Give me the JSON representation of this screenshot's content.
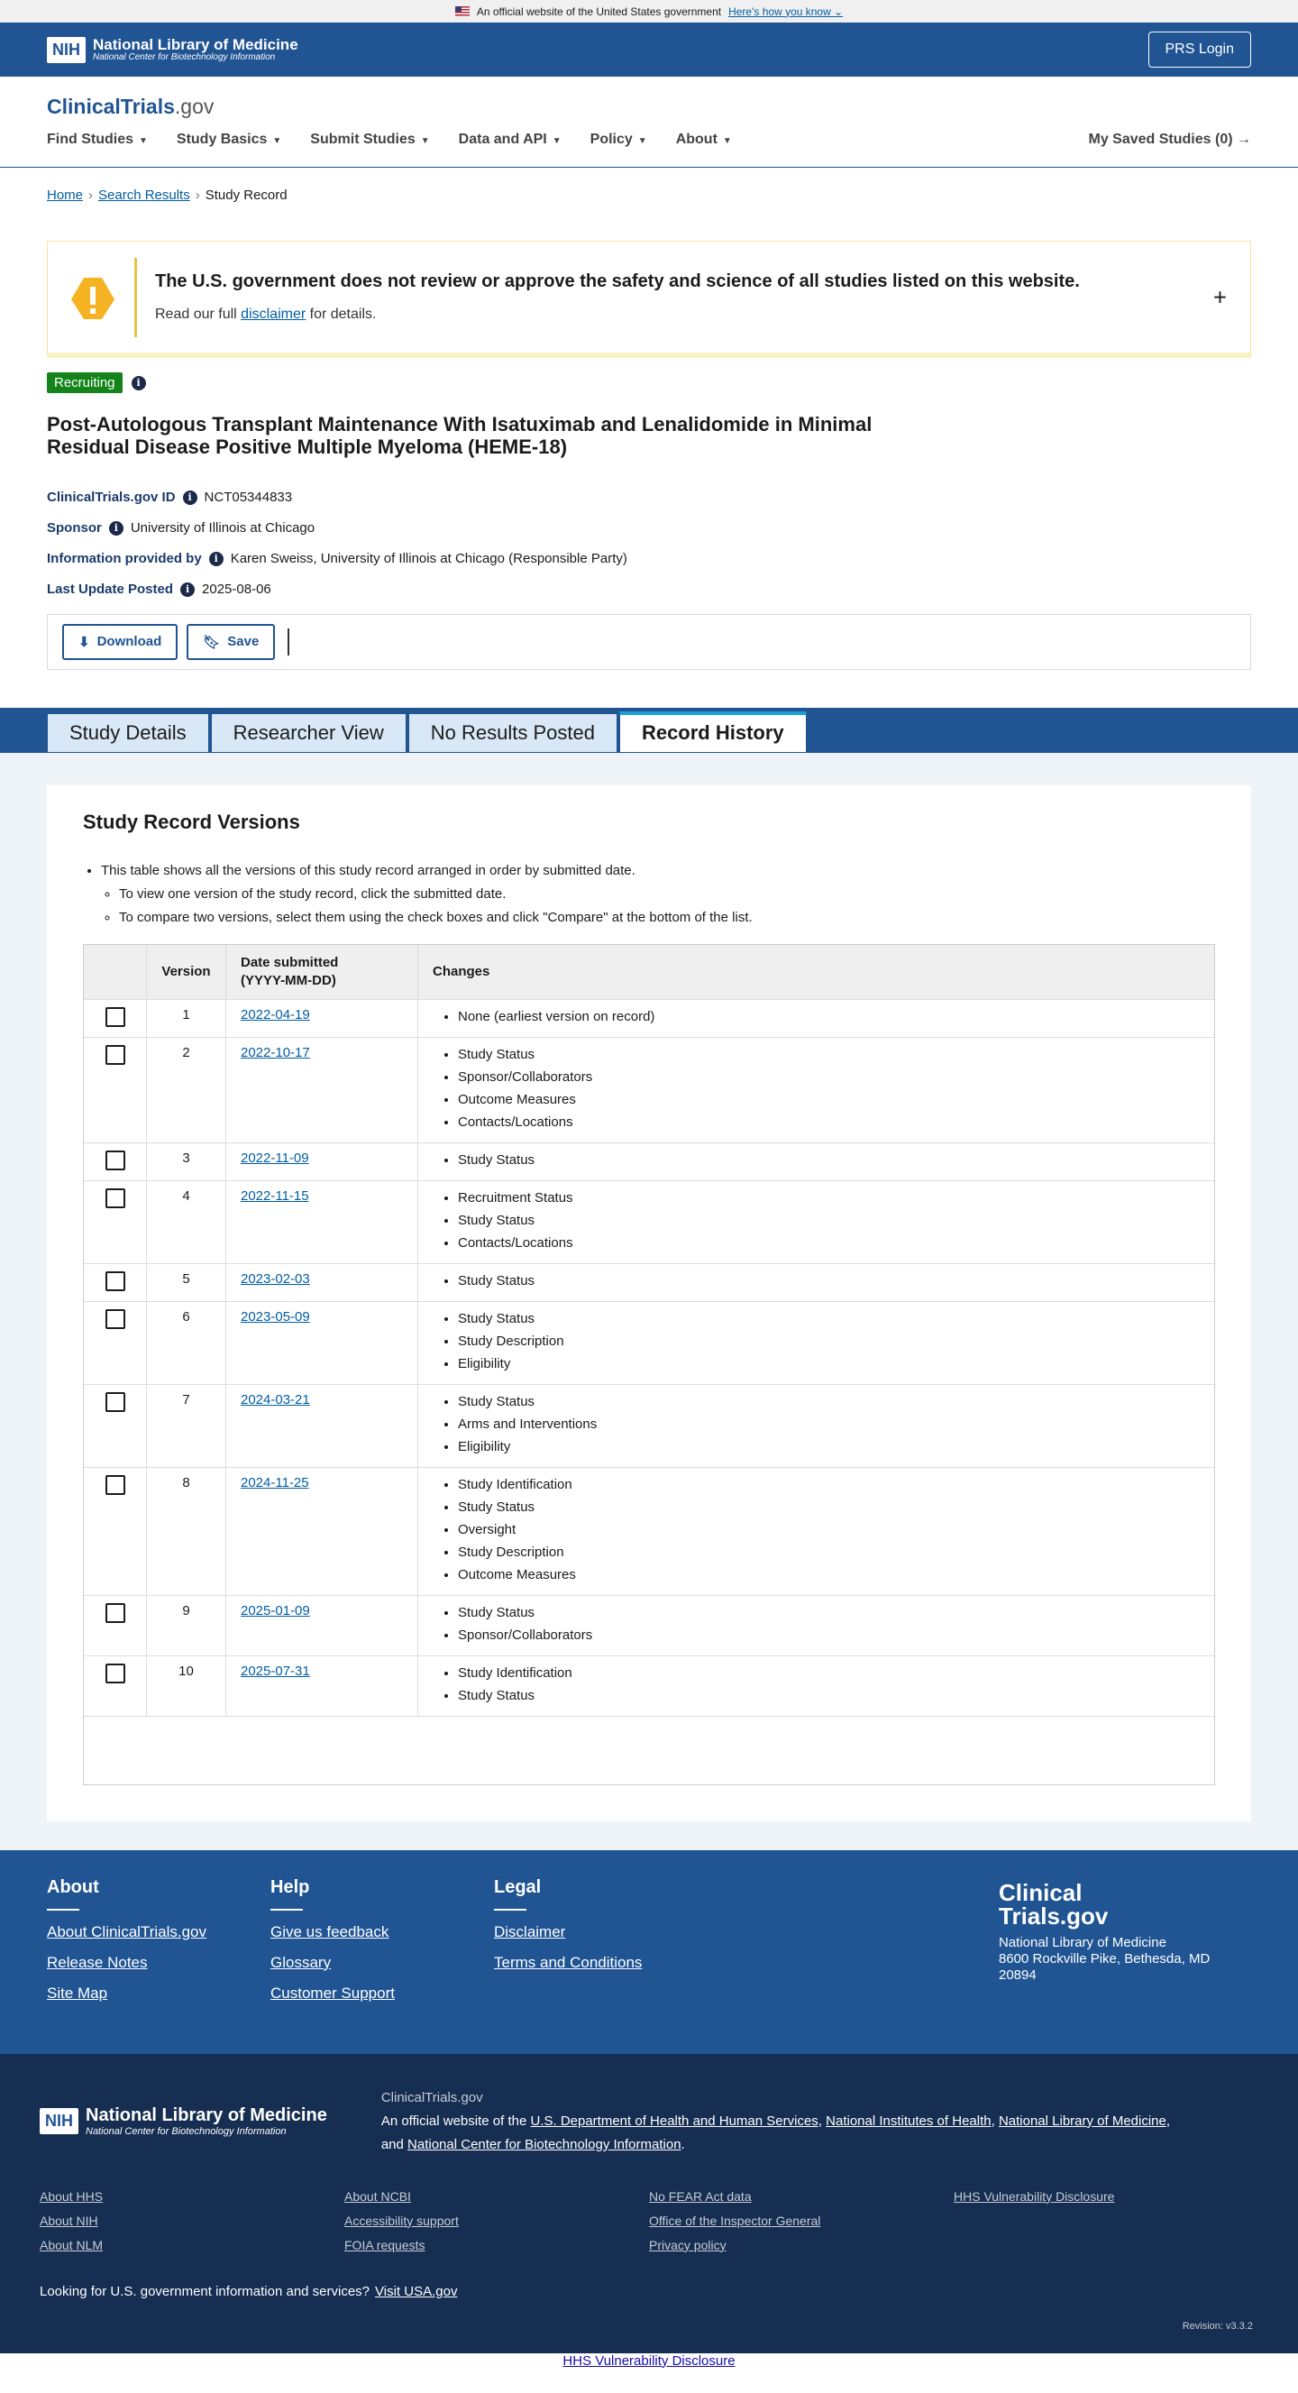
{
  "gov_banner": {
    "text": "An official website of the United States government",
    "link": "Here's how you know"
  },
  "nih": {
    "logo_box": "NIH",
    "title": "National Library of Medicine",
    "subtitle": "National Center for Biotechnology Information",
    "prs_login": "PRS Login"
  },
  "site": {
    "logo_main": "ClinicalTrials",
    "logo_gov": ".gov"
  },
  "nav": {
    "items": [
      "Find Studies",
      "Study Basics",
      "Submit Studies",
      "Data and API",
      "Policy",
      "About"
    ],
    "saved": "My Saved Studies (0)"
  },
  "breadcrumb": {
    "home": "Home",
    "search": "Search Results",
    "current": "Study Record"
  },
  "disclaimer": {
    "title": "The U.S. government does not review or approve the safety and science of all studies listed on this website.",
    "pre": "Read our full",
    "link": "disclaimer",
    "post": "for details."
  },
  "study": {
    "status": "Recruiting",
    "title": "Post-Autologous Transplant Maintenance With Isatuximab and Lenalidomide in Minimal Residual Disease Positive Multiple Myeloma (HEME-18)",
    "id_label": "ClinicalTrials.gov ID",
    "id_value": "NCT05344833",
    "sponsor_label": "Sponsor",
    "sponsor_value": "University of Illinois at Chicago",
    "info_label": "Information provided by",
    "info_value": "Karen Sweiss, University of Illinois at Chicago (Responsible Party)",
    "update_label": "Last Update Posted",
    "update_value": "2025-08-06"
  },
  "actions": {
    "download": "Download",
    "save": "Save"
  },
  "tabs": [
    "Study Details",
    "Researcher View",
    "No Results Posted",
    "Record History"
  ],
  "versions": {
    "heading": "Study Record Versions",
    "note1": "This table shows all the versions of this study record arranged in order by submitted date.",
    "note2": "To view one version of the study record, click the submitted date.",
    "note3": "To compare two versions, select them using the check boxes and click \"Compare\" at the bottom of the list.",
    "col_version": "Version",
    "col_date_1": "Date submitted",
    "col_date_2": "(YYYY-MM-DD)",
    "col_changes": "Changes",
    "rows": [
      {
        "version": "1",
        "date": "2022-04-19",
        "changes": [
          "None (earliest version on record)"
        ]
      },
      {
        "version": "2",
        "date": "2022-10-17",
        "changes": [
          "Study Status",
          "Sponsor/Collaborators",
          "Outcome Measures",
          "Contacts/Locations"
        ]
      },
      {
        "version": "3",
        "date": "2022-11-09",
        "changes": [
          "Study Status"
        ]
      },
      {
        "version": "4",
        "date": "2022-11-15",
        "changes": [
          "Recruitment Status",
          "Study Status",
          "Contacts/Locations"
        ]
      },
      {
        "version": "5",
        "date": "2023-02-03",
        "changes": [
          "Study Status"
        ]
      },
      {
        "version": "6",
        "date": "2023-05-09",
        "changes": [
          "Study Status",
          "Study Description",
          "Eligibility"
        ]
      },
      {
        "version": "7",
        "date": "2024-03-21",
        "changes": [
          "Study Status",
          "Arms and Interventions",
          "Eligibility"
        ]
      },
      {
        "version": "8",
        "date": "2024-11-25",
        "changes": [
          "Study Identification",
          "Study Status",
          "Oversight",
          "Study Description",
          "Outcome Measures"
        ]
      },
      {
        "version": "9",
        "date": "2025-01-09",
        "changes": [
          "Study Status",
          "Sponsor/Collaborators"
        ]
      },
      {
        "version": "10",
        "date": "2025-07-31",
        "changes": [
          "Study Identification",
          "Study Status"
        ]
      }
    ]
  },
  "footer": {
    "about": {
      "heading": "About",
      "links": [
        "About ClinicalTrials.gov",
        "Release Notes",
        "Site Map"
      ]
    },
    "help": {
      "heading": "Help",
      "links": [
        "Give us feedback",
        "Glossary",
        "Customer Support"
      ]
    },
    "legal": {
      "heading": "Legal",
      "links": [
        "Disclaimer",
        "Terms and Conditions"
      ]
    },
    "brand_1": "Clinical",
    "brand_2": "Trials.gov",
    "address_1": "National Library of Medicine",
    "address_2": "8600 Rockville Pike, Bethesda, MD",
    "address_3": "20894"
  },
  "footer2": {
    "logo_box": "NIH",
    "title": "National Library of Medicine",
    "subtitle": "National Center for Biotechnology Information",
    "site": "ClinicalTrials.gov",
    "official_pre": "An official website of the",
    "hhs": "U.S. Department of Health and Human Services",
    "nih": "National Institutes of Health",
    "nlm": "National Library of Medicine",
    "and": "and",
    "ncbi": "National Center for Biotechnology Information",
    "col1": [
      "About HHS",
      "About NIH",
      "About NLM"
    ],
    "col2": [
      "About NCBI",
      "Accessibility support",
      "FOIA requests"
    ],
    "col3": [
      "No FEAR Act data",
      "Office of the Inspector General",
      "Privacy policy"
    ],
    "col4": [
      "HHS Vulnerability Disclosure"
    ],
    "looking": "Looking for U.S. government information and services?",
    "usa": "Visit USA.gov",
    "revision": "Revision: v3.3.2"
  },
  "tail_link": "HHS Vulnerability Disclosure"
}
